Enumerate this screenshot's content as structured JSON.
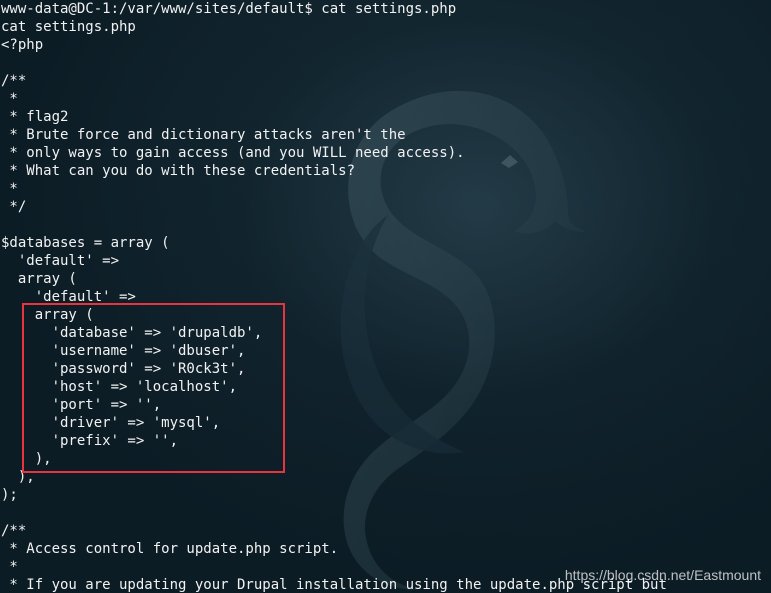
{
  "terminal": {
    "lines": [
      "www-data@DC-1:/var/www/sites/default$ cat settings.php",
      "cat settings.php",
      "<?php",
      "",
      "/**",
      " *",
      " * flag2",
      " * Brute force and dictionary attacks aren't the",
      " * only ways to gain access (and you WILL need access).",
      " * What can you do with these credentials?",
      " *",
      " */",
      "",
      "$databases = array (",
      "  'default' =>",
      "  array (",
      "    'default' =>",
      "    array (",
      "      'database' => 'drupaldb',",
      "      'username' => 'dbuser',",
      "      'password' => 'R0ck3t',",
      "      'host' => 'localhost',",
      "      'port' => '',",
      "      'driver' => 'mysql',",
      "      'prefix' => '',",
      "    ),",
      "  ),",
      ");",
      "",
      "/**",
      " * Access control for update.php script.",
      " *",
      " * If you are updating your Drupal installation using the update.php script but"
    ]
  },
  "watermark": {
    "text": "https://blog.csdn.net/Eastmount"
  },
  "colors": {
    "terminal_text": "#f2f2f2",
    "highlight_border": "#e7343f",
    "background": "#0d1b24"
  }
}
